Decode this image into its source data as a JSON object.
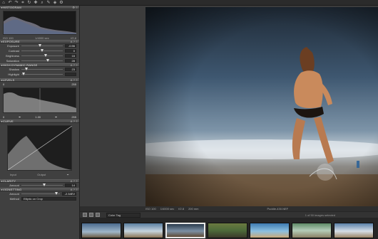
{
  "toolbar": {
    "icons": [
      "home-icon",
      "back-icon",
      "forward-icon",
      "crop-icon",
      "rotate-icon",
      "pick-icon",
      "search-icon",
      "brush-icon",
      "tag-icon",
      "gear-icon"
    ]
  },
  "histogram": {
    "title": "HISTOGRAM",
    "iso": "ISO 100",
    "shutter": "1/4000 sec",
    "aperture": "f/2,8"
  },
  "exposure": {
    "title": "EXPOSURE",
    "rows": [
      {
        "label": "Exposure",
        "value": "-0.56",
        "level": 0.45
      },
      {
        "label": "Contrast",
        "value": "0",
        "level": 0.5
      },
      {
        "label": "Brightness",
        "value": "16",
        "level": 0.58
      },
      {
        "label": "Saturation",
        "value": "28",
        "level": 0.64
      }
    ]
  },
  "hdr": {
    "title": "HIGH DYNAMIC RANGE",
    "rows": [
      {
        "label": "Shadow",
        "value": "23",
        "level": 0.12
      },
      {
        "label": "Highlight",
        "value": "",
        "level": 0.05
      }
    ]
  },
  "levels": {
    "title": "LEVELS",
    "top_left": "0",
    "top_right": "255",
    "bottom_left": "0",
    "bottom_mid": "1.00",
    "bottom_right": "255"
  },
  "curve": {
    "title": "CURVE",
    "input_label": "Input",
    "output_label": "Output"
  },
  "clarity": {
    "title": "CLARITY",
    "rows": [
      {
        "label": "Amount",
        "value": "14",
        "level": 0.55
      }
    ]
  },
  "vignetting": {
    "title": "VIGNETTING",
    "rows": [
      {
        "label": "Amount",
        "value": "-2.34EV",
        "level": 0.9
      }
    ],
    "method_label": "Method",
    "method_value": "Elliptic on Crop"
  },
  "status": {
    "iso": "ISO 100",
    "shutter": "1/4000 sec",
    "aperture": "f/2.8",
    "focal": "200 mm",
    "filename": "Puddle-430.NEF"
  },
  "filmbar": {
    "sort_value": "Color Tag",
    "count_text": "1 of 50 images selected"
  },
  "colors": {
    "panel_bg": "#404040",
    "accent_selected": "#e8e8e8"
  }
}
